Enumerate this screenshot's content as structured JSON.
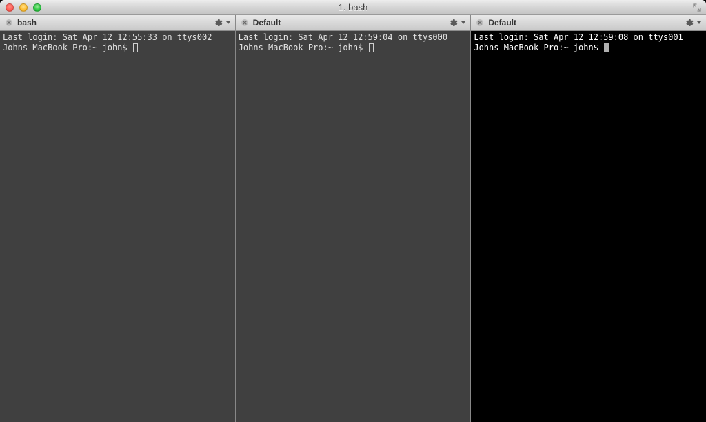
{
  "window": {
    "title": "1. bash"
  },
  "panes": [
    {
      "tab_title": "bash",
      "theme": "gray",
      "last_login": "Last login: Sat Apr 12 12:55:33 on ttys002",
      "prompt": "Johns-MacBook-Pro:~ john$ ",
      "cursor": "outline"
    },
    {
      "tab_title": "Default",
      "theme": "gray",
      "last_login": "Last login: Sat Apr 12 12:59:04 on ttys000",
      "prompt": "Johns-MacBook-Pro:~ john$ ",
      "cursor": "outline"
    },
    {
      "tab_title": "Default",
      "theme": "black",
      "last_login": "Last login: Sat Apr 12 12:59:08 on ttys001",
      "prompt": "Johns-MacBook-Pro:~ john$ ",
      "cursor": "block"
    }
  ]
}
